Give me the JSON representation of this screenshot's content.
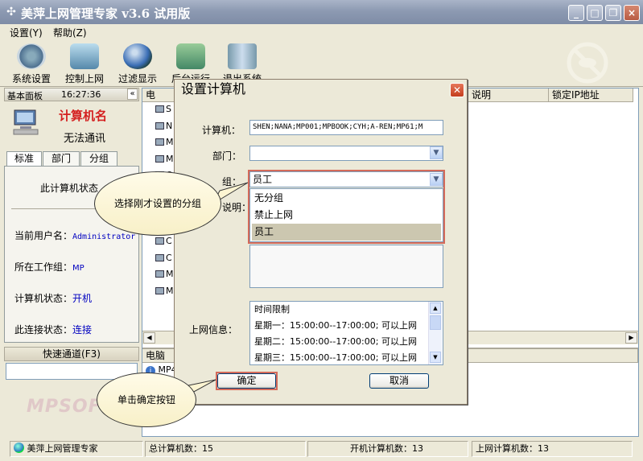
{
  "window": {
    "title": "美萍上网管理专家 v3.6 试用版",
    "minimize": "_",
    "maximize": "□",
    "close": "×"
  },
  "menu": {
    "settings": "设置(Y)",
    "help": "帮助(Z)"
  },
  "toolbar": {
    "system": "系统设置",
    "control": "控制上网",
    "filter": "过滤显示",
    "background": "后台运行",
    "exit": "退出系统"
  },
  "left": {
    "header_title": "基本面板",
    "header_time": "16:27:36",
    "computer_name": "计算机名",
    "computer_status_msg": "无法通讯",
    "tabs": [
      "标准",
      "部门",
      "分组"
    ],
    "state_heading": "此计算机状态",
    "user_label": "当前用户名：",
    "user_value": "Administrator",
    "workgroup_label": "所在工作组：",
    "workgroup_value": "MP",
    "pc_state_label": "计算机状态：",
    "pc_state_value": "开机",
    "conn_label": "此连接状态：",
    "conn_value": "连接",
    "quick_label": "快速通道(F3)",
    "brand": "MPSOFT"
  },
  "grid": {
    "headers": [
      "电",
      "说明",
      "锁定IP地址"
    ],
    "rows": [
      "S",
      "N",
      "M",
      "M",
      "C",
      "M",
      "M",
      "M",
      "C",
      "C",
      "M",
      "M"
    ],
    "bottom_header": "电脑",
    "bottom_row": "MP45"
  },
  "dialog": {
    "title": "设置计算机",
    "computer_label": "计算机：",
    "computer_value": "SHEN;NANA;MP001;MPBOOK;CYH;A-REN;MP61;M",
    "dept_label": "部门：",
    "group_label": "组：",
    "group_value": "员工",
    "desc_label": "说明：",
    "group_options": [
      "无分组",
      "禁止上网",
      "员工"
    ],
    "online_label": "上网信息：",
    "online_lines": [
      "时间限制",
      "星期一：15:00:00--17:00:00; 可以上网",
      "星期二：15:00:00--17:00:00; 可以上网",
      "星期三：15:00:00--17:00:00; 可以上网"
    ],
    "ok": "确定",
    "cancel": "取消"
  },
  "bubbles": {
    "group_hint": "选择刚才设置的分组",
    "ok_hint": "单击确定按钮"
  },
  "status": {
    "app": "美萍上网管理专家",
    "total": "总计算机数：15",
    "on": "开机计算机数：13",
    "online": "上网计算机数：13"
  }
}
